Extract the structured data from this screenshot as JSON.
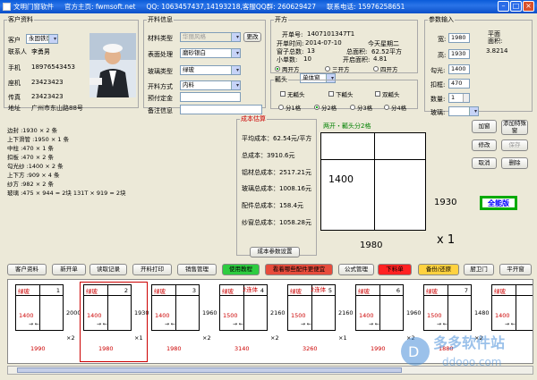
{
  "title": {
    "app": "文明门窗软件",
    "site": "官方主页: fwmsoft.net",
    "qq": "QQ: 1063457437,14193218,客服QQ群: 260629427",
    "phone": "联系电话: 15976258651"
  },
  "customer": {
    "legend": "客户资料",
    "labels": [
      "客户",
      "联系人",
      "手机",
      "座机",
      "传真",
      "地址"
    ],
    "values": [
      "永固铁饰",
      "李勇男",
      "18976543453",
      "23423423",
      "23423423",
      "广州市东山路88号"
    ]
  },
  "material": {
    "legend": "开料信息",
    "labels": [
      "材料类型",
      "表面处理",
      "玻璃类型",
      "开料方式",
      "预付定金",
      "备注信息"
    ],
    "values": [
      "华丽风格",
      "磨砂银白",
      "绿玻",
      "内料",
      "",
      ""
    ],
    "change_btn": "更改"
  },
  "opening": {
    "legend": "开方",
    "order_no_label": "开单号:",
    "order_no": "1407101347T1",
    "date_label": "开单时间:",
    "date": "2014-07-10",
    "weekday": "今天星期二",
    "seq_label": "窗子总数:",
    "seq": "13",
    "area_label": "总面积:",
    "area": "62.52平方",
    "count_label": "小单数:",
    "count": "10",
    "open_area_label": "开启面积:",
    "open_area": "4.81",
    "modes": [
      "两开方",
      "三开方",
      "四开方"
    ],
    "window_type": "单体窗"
  },
  "hooks": {
    "legend": "瓤头",
    "options": [
      "无瓤头",
      "下瓤头",
      "双瓤头"
    ],
    "splits": [
      "分1格",
      "分2格",
      "分3格",
      "分4格"
    ]
  },
  "params": {
    "legend": "参数输入",
    "labels": [
      "宽:",
      "高:",
      "勾光:",
      "扣框:",
      "数量:",
      "玻璃:"
    ],
    "values": [
      "1980",
      "1930",
      "1400",
      "470",
      "1",
      ""
    ],
    "area_label": "平面面积:",
    "area": "3.8214"
  },
  "cut_list": [
    "边封      :1930 × 2 条",
    "上下滑管  :1950 × 1 条",
    "中柱      :470 × 1 条",
    "扣板      :470 × 2 条",
    "勾光纱    :1400 × 2 条",
    "上下方    :909 × 4 条",
    "纱方      :982 × 2 条",
    "玻璃      :475 × 944 = 2块  131T × 919 = 2块"
  ],
  "cost": {
    "legend": "成本估算",
    "rows": [
      "平均成本：62.54元/平方",
      "总成本：3910.6元",
      "铝材总成本：2517.21元",
      "玻璃总成本：1008.16元",
      "配件总成本：158.4元",
      "纱窗总成本：1058.28元"
    ],
    "settings_btn": "成本参数设置"
  },
  "preview": {
    "title": "两开・瓤头分2格",
    "width": "1980",
    "height": "1930",
    "left_w": "1400",
    "qty": "x 1"
  },
  "side_buttons": [
    "加窗",
    "添加特殊窗",
    "修改",
    "保存",
    "取消",
    "删除"
  ],
  "brand_badge": "全能版",
  "toolbar": [
    "客户资料",
    "新开单",
    "读取记录",
    "开料打印",
    "销售管理",
    "使用教程",
    "看着哪些配件更便宜",
    "公式管理",
    "下料单",
    "备份/还原",
    "厨卫门",
    "平开窗"
  ],
  "toolbar_colors": {
    "help": "#2ecc40",
    "cheap": "#e74c3c",
    "cut": "#ff2222",
    "backup": "#ffd23f"
  },
  "cards": [
    {
      "glass": "绿玻",
      "no": "1",
      "w": "1400",
      "h": "2000",
      "total": "1990",
      "qty": "×2"
    },
    {
      "glass": "绿玻",
      "no": "2",
      "w": "1400",
      "h": "1930",
      "total": "1980",
      "qty": "×1"
    },
    {
      "glass": "绿玻",
      "no": "3",
      "w": "1400",
      "h": "1960",
      "total": "1980",
      "qty": "×2"
    },
    {
      "glass": "绿玻",
      "no": "4",
      "w": "1500",
      "h": "2160",
      "total": "3140",
      "qty": "×2",
      "tag": "2连体"
    },
    {
      "glass": "绿玻",
      "no": "5",
      "w": "1500",
      "h": "2160",
      "total": "3260",
      "qty": "×1",
      "tag": "2连体"
    },
    {
      "glass": "绿玻",
      "no": "6",
      "w": "1400",
      "h": "1960",
      "total": "1990",
      "qty": "×2"
    },
    {
      "glass": "绿玻",
      "no": "7",
      "w": "1500",
      "h": "1480",
      "total": "1880",
      "qty": "×2"
    },
    {
      "glass": "绿玻",
      "no": "8",
      "w": "1400",
      "h": "1480",
      "total": "",
      "qty": "×2"
    }
  ],
  "watermark": {
    "cn": "多多软件站",
    "en": "ddooo.com"
  }
}
